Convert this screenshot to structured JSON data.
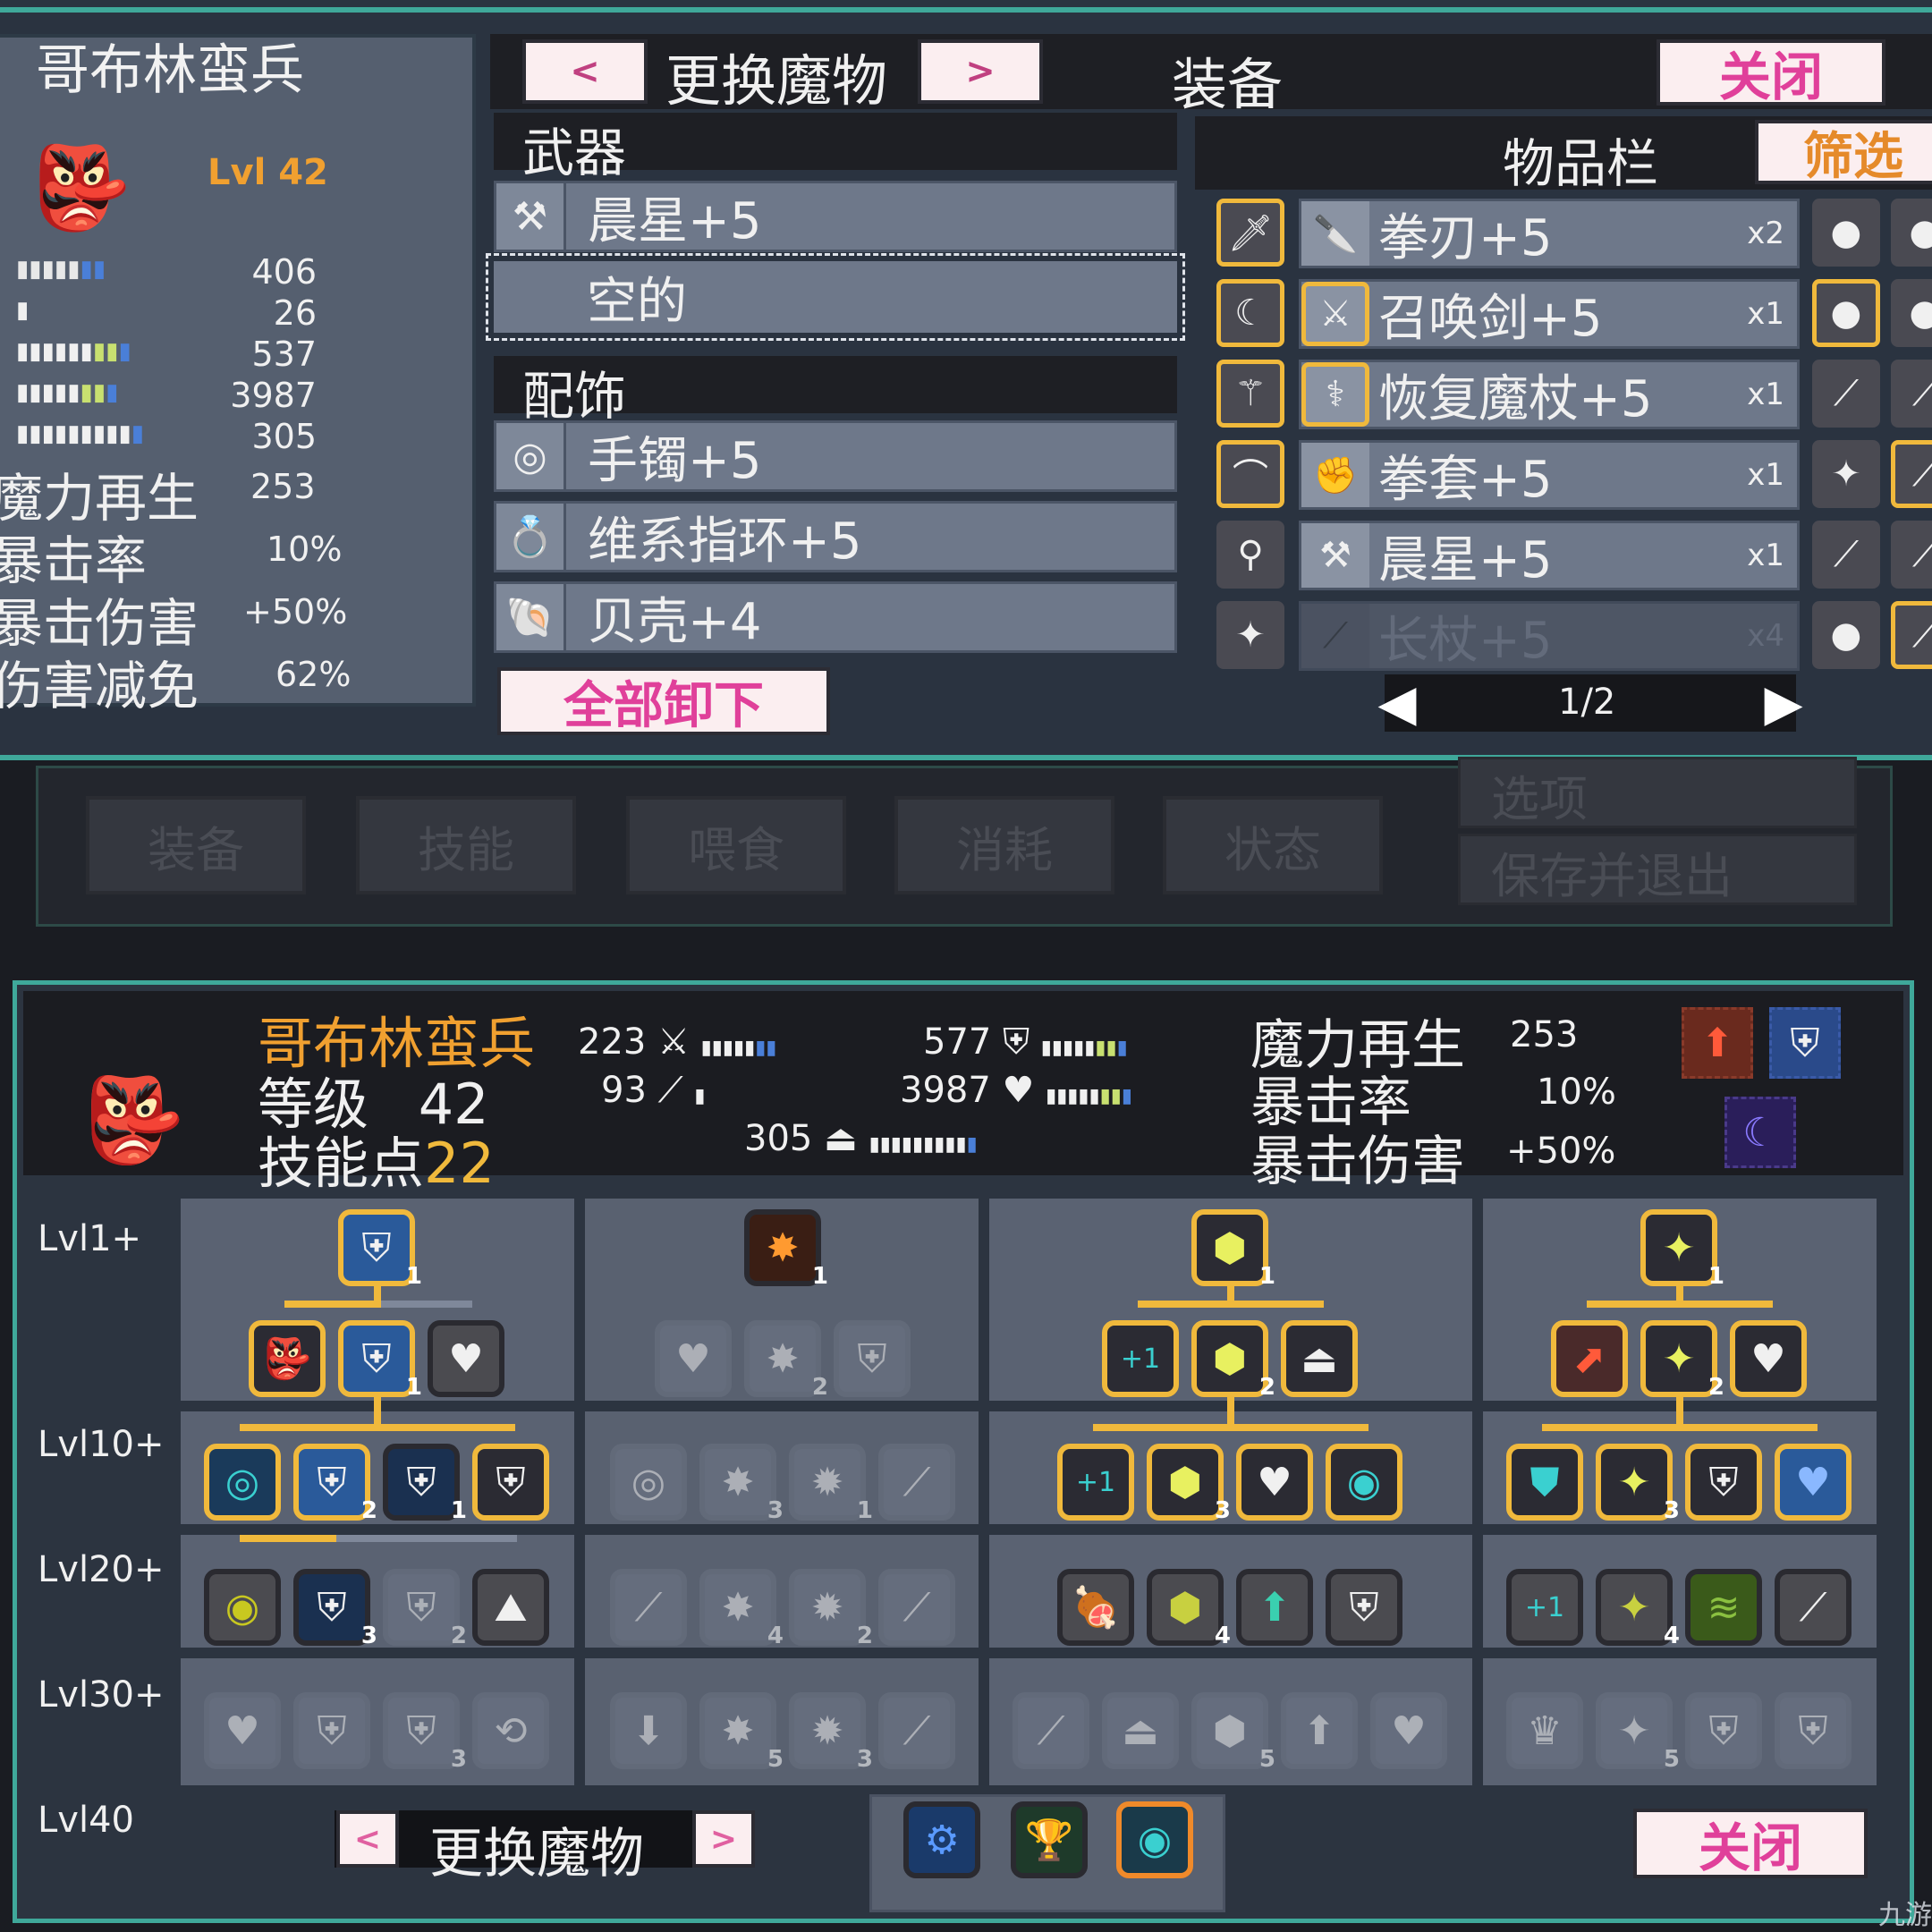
{
  "top": {
    "monster_name": "哥布林蛮兵",
    "level": "Lvl 42",
    "stat_values": [
      "406",
      "26",
      "537",
      "3987",
      "305"
    ],
    "extra_stats": [
      {
        "label": "魔力再生",
        "value": "253"
      },
      {
        "label": "暴击率",
        "value": "10%"
      },
      {
        "label": "暴击伤害",
        "value": "+50%"
      },
      {
        "label": "伤害减免",
        "value": "62%"
      }
    ],
    "prev_label": "<",
    "change_monster": "更换魔物",
    "next_label": ">",
    "equip_title": "装备",
    "close": "关闭",
    "weapon_header": "武器",
    "weapons": [
      "晨星+5",
      "空的"
    ],
    "accessory_header": "配饰",
    "accessories": [
      "手镯+5",
      "维系指环+5",
      "贝壳+4"
    ],
    "unequip_all": "全部卸下",
    "inventory_title": "物品栏",
    "filter": "筛选",
    "inventory": [
      {
        "name": "拳刃+5",
        "qty": "x2"
      },
      {
        "name": "召唤剑+5",
        "qty": "x1"
      },
      {
        "name": "恢复魔杖+5",
        "qty": "x1"
      },
      {
        "name": "拳套+5",
        "qty": "x1"
      },
      {
        "name": "晨星+5",
        "qty": "x1"
      },
      {
        "name": "长杖+5",
        "qty": "x4"
      }
    ],
    "page": "1/2"
  },
  "menu": {
    "tabs": [
      "装备",
      "技能",
      "喂食",
      "消耗",
      "状态"
    ],
    "options": "选项",
    "save_exit": "保存并退出"
  },
  "bottom": {
    "monster_name": "哥布林蛮兵",
    "level_label": "等级",
    "level": "42",
    "skill_points_label": "技能点",
    "skill_points": "22",
    "stats": [
      {
        "value": "223"
      },
      {
        "value": "93"
      },
      {
        "value": "577"
      },
      {
        "value": "3987"
      },
      {
        "value": "305"
      }
    ],
    "extra_stats": [
      {
        "label": "魔力再生",
        "value": "253"
      },
      {
        "label": "暴击率",
        "value": "10%"
      },
      {
        "label": "暴击伤害",
        "value": "+50%"
      }
    ],
    "tiers": [
      "Lvl1+",
      "Lvl10+",
      "Lvl20+",
      "Lvl30+",
      "Lvl40"
    ],
    "change_monster": "更换魔物",
    "prev_label": "<",
    "next_label": ">",
    "close": "关闭"
  },
  "colors": {
    "accent": "#f0b93c",
    "pink": "#e0409a",
    "orange_name": "#f0a030",
    "teal": "#3fa89a"
  },
  "watermark": "九游"
}
